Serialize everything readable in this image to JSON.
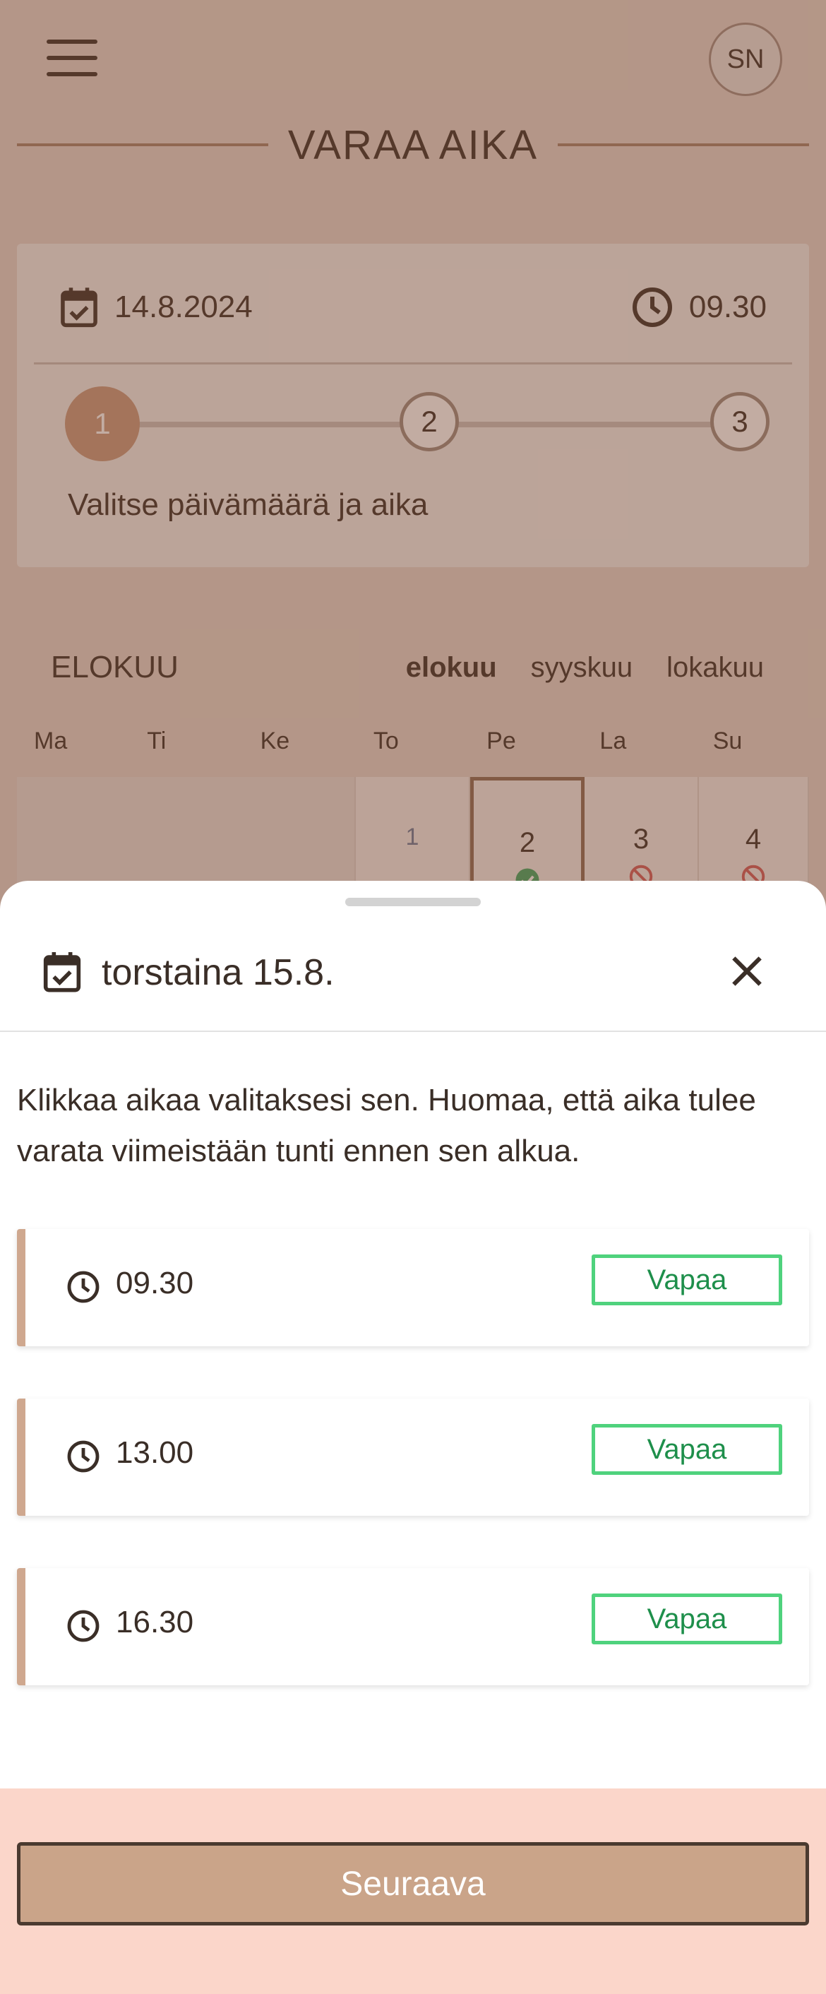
{
  "header": {
    "avatar_initials": "SN",
    "title": "VARAA AIKA"
  },
  "summary": {
    "date": "14.8.2024",
    "time": "09.30",
    "steps": [
      "1",
      "2",
      "3"
    ],
    "active_step": 1,
    "step_label": "Valitse päivämäärä ja aika"
  },
  "calendar": {
    "month": "ELOKUU",
    "month_links": [
      {
        "label": "elokuu",
        "active": true
      },
      {
        "label": "syyskuu",
        "active": false
      },
      {
        "label": "lokakuu",
        "active": false
      }
    ],
    "weekdays": [
      "Ma",
      "Ti",
      "Ke",
      "To",
      "Pe",
      "La",
      "Su"
    ],
    "days": [
      {
        "num": "1",
        "status": "none"
      },
      {
        "num": "2",
        "status": "available",
        "selected": true
      },
      {
        "num": "3",
        "status": "unavailable"
      },
      {
        "num": "4",
        "status": "unavailable"
      }
    ]
  },
  "sheet": {
    "title": "torstaina 15.8.",
    "instructions": "Klikkaa aikaa valitaksesi sen. Huomaa, että aika tulee varata viimeistään tunti ennen sen alkua.",
    "slots": [
      {
        "time": "09.30",
        "status": "Vapaa"
      },
      {
        "time": "13.00",
        "status": "Vapaa"
      },
      {
        "time": "16.30",
        "status": "Vapaa"
      }
    ],
    "next_label": "Seuraava"
  },
  "colors": {
    "accent": "#caa489",
    "available_border": "#4fd27d",
    "available_text": "#1e8f4b",
    "footer_bg": "#fbd6ca"
  }
}
